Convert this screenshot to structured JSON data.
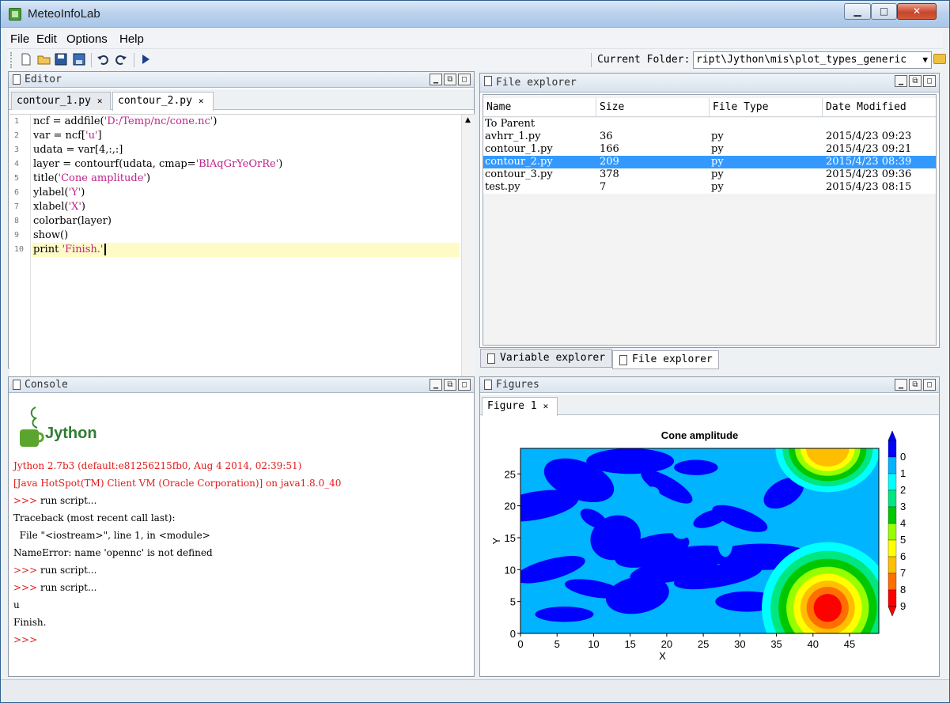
{
  "window": {
    "title": "MeteoInfoLab",
    "controls": {
      "minimize": "▁",
      "maximize": "□",
      "close": "✕"
    }
  },
  "menu": [
    "File",
    "Edit",
    "Options",
    "Help"
  ],
  "toolbar": {
    "icons": [
      "new-file-icon",
      "open-folder-icon",
      "save-icon",
      "save-as-icon",
      "undo-icon",
      "redo-icon",
      "run-icon"
    ],
    "current_folder_label": "Current Folder:",
    "current_folder_value": "ript\\Jython\\mis\\plot_types_generic"
  },
  "editor": {
    "panel_title": "Editor",
    "tabs": [
      {
        "label": "contour_1.py",
        "active": false
      },
      {
        "label": "contour_2.py",
        "active": true
      }
    ],
    "lines": [
      "ncf = addfile('D:/Temp/nc/cone.nc')",
      "var = ncf['u']",
      "udata = var[4,:,:]",
      "layer = contourf(udata, cmap='BlAqGrYeOrRe')",
      "title('Cone amplitude')",
      "ylabel('Y')",
      "xlabel('X')",
      "colorbar(layer)",
      "show()",
      "print 'Finish.'"
    ],
    "current_line": 10
  },
  "file_explorer": {
    "panel_title": "File explorer",
    "columns": [
      "Name",
      "Size",
      "File Type",
      "Date Modified"
    ],
    "parent_label": "To Parent",
    "rows": [
      {
        "name": "avhrr_1.py",
        "size": "36",
        "type": "py",
        "date": "2015/4/23 09:23",
        "selected": false
      },
      {
        "name": "contour_1.py",
        "size": "166",
        "type": "py",
        "date": "2015/4/23 09:21",
        "selected": false
      },
      {
        "name": "contour_2.py",
        "size": "209",
        "type": "py",
        "date": "2015/4/23 08:39",
        "selected": true
      },
      {
        "name": "contour_3.py",
        "size": "378",
        "type": "py",
        "date": "2015/4/23 09:36",
        "selected": false
      },
      {
        "name": "test.py",
        "size": "7",
        "type": "py",
        "date": "2015/4/23 08:15",
        "selected": false
      }
    ],
    "bottom_tabs": [
      {
        "label": "Variable explorer",
        "active": false
      },
      {
        "label": "File explorer",
        "active": true
      }
    ]
  },
  "console": {
    "panel_title": "Console",
    "logo_text": "Jython",
    "lines": [
      {
        "text": "Jython 2.7b3 (default:e81256215fb0, Aug 4 2014, 02:39:51)",
        "red": true
      },
      {
        "text": "[Java HotSpot(TM) Client VM (Oracle Corporation)] on java1.8.0_40",
        "red": true
      },
      {
        "text": ">>> run script...",
        "red": false,
        "prompt": true
      },
      {
        "text": "Traceback (most recent call last):",
        "red": false
      },
      {
        "text": "  File \"<iostream>\", line 1, in <module>",
        "red": false
      },
      {
        "text": "NameError: name 'opennc' is not defined",
        "red": false
      },
      {
        "text": ">>> run script...",
        "red": false,
        "prompt": true
      },
      {
        "text": ">>> run script...",
        "red": false,
        "prompt": true
      },
      {
        "text": "u",
        "red": false
      },
      {
        "text": "Finish.",
        "red": false
      },
      {
        "text": ">>>",
        "red": true
      }
    ]
  },
  "figures": {
    "panel_title": "Figures",
    "tab_label": "Figure 1"
  },
  "chart_data": {
    "type": "heatmap",
    "title": "Cone amplitude",
    "xlabel": "X",
    "ylabel": "Y",
    "xlim": [
      0,
      49
    ],
    "ylim": [
      0,
      29
    ],
    "xticks": [
      0,
      5,
      10,
      15,
      20,
      25,
      30,
      35,
      40,
      45
    ],
    "yticks": [
      0,
      5,
      10,
      15,
      20,
      25
    ],
    "colorbar_levels": [
      "0",
      "1",
      "2",
      "3",
      "4",
      "5",
      "6",
      "7",
      "8",
      "9"
    ],
    "colors": [
      "#0000ff",
      "#00b4ff",
      "#00ffff",
      "#00e680",
      "#00c800",
      "#96ff00",
      "#ffff00",
      "#ffbe00",
      "#ff6e00",
      "#ff0000"
    ],
    "features": [
      {
        "label": "peak",
        "x": 42,
        "y": 4,
        "value": 9
      },
      {
        "label": "peak",
        "x": 42,
        "y": 29,
        "value": 7
      }
    ]
  },
  "colors": {
    "selection": "#3399ff",
    "string": "#c0218c",
    "error_red": "#e21a1a",
    "current_line": "#fefbc6"
  }
}
